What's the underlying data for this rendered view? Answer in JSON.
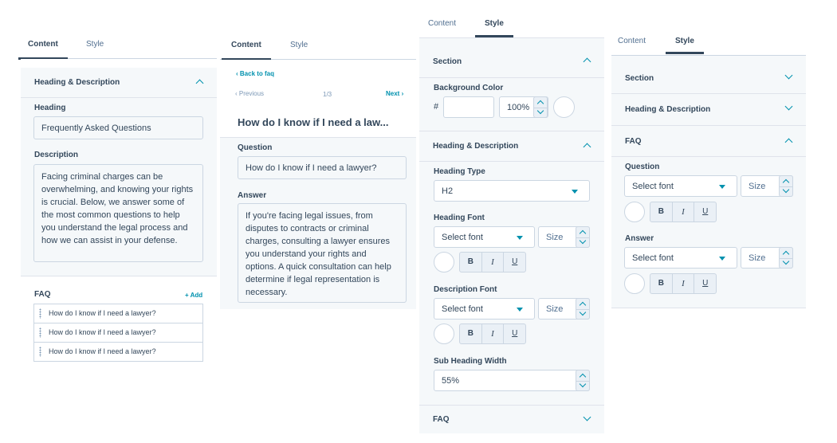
{
  "panel1": {
    "tabs": [
      "Content",
      "Style"
    ],
    "section": "Heading & Description",
    "heading_label": "Heading",
    "heading_value": "Frequently Asked Questions",
    "description_label": "Description",
    "description_value": "Facing criminal charges can be overwhelming, and knowing your rights is crucial. Below, we answer some of the most common questions to help you understand the legal process and how we can assist in your defense.",
    "faq_label": "FAQ",
    "add_label": "+ Add",
    "faq_items": [
      "How do I know if I need a lawyer?",
      "How do I know if I need a lawyer?",
      "How do I know if I need a lawyer?"
    ]
  },
  "panel2": {
    "tabs": [
      "Content",
      "Style"
    ],
    "back_label": "Back to faq",
    "previous_label": "Previous",
    "page_indicator": "1/3",
    "next_label": "Next",
    "title": "How do I know if I need a law...",
    "question_label": "Question",
    "question_value": "How do I know if I need a lawyer?",
    "answer_label": "Answer",
    "answer_value": "If you're facing legal issues, from disputes to contracts or criminal charges, consulting a lawyer ensures you understand your rights and options. A quick consultation can help determine if legal representation is necessary."
  },
  "panel3": {
    "tabs": [
      "Content",
      "Style"
    ],
    "section_label": "Section",
    "bg_color_label": "Background Color",
    "hash": "#",
    "bg_color_value": "",
    "opacity_value": "100%",
    "hd_section": "Heading & Description",
    "heading_type_label": "Heading Type",
    "heading_type_value": "H2",
    "heading_font_label": "Heading Font",
    "select_font": "Select font",
    "size_placeholder": "Size",
    "desc_font_label": "Description Font",
    "sub_width_label": "Sub Heading Width",
    "sub_width_value": "55%",
    "faq_label": "FAQ",
    "fmt_b": "B",
    "fmt_i": "I",
    "fmt_u": "U"
  },
  "panel4": {
    "tabs": [
      "Content",
      "Style"
    ],
    "section_label": "Section",
    "hd_label": "Heading & Description",
    "faq_label": "FAQ",
    "question_label": "Question",
    "answer_label": "Answer",
    "select_font": "Select font",
    "size_placeholder": "Size",
    "fmt_b": "B",
    "fmt_i": "I",
    "fmt_u": "U"
  },
  "colors": {
    "accent": "#0091ae",
    "text": "#33475b",
    "panel_bg": "#f5f8fa",
    "border": "#cbd6e2"
  }
}
